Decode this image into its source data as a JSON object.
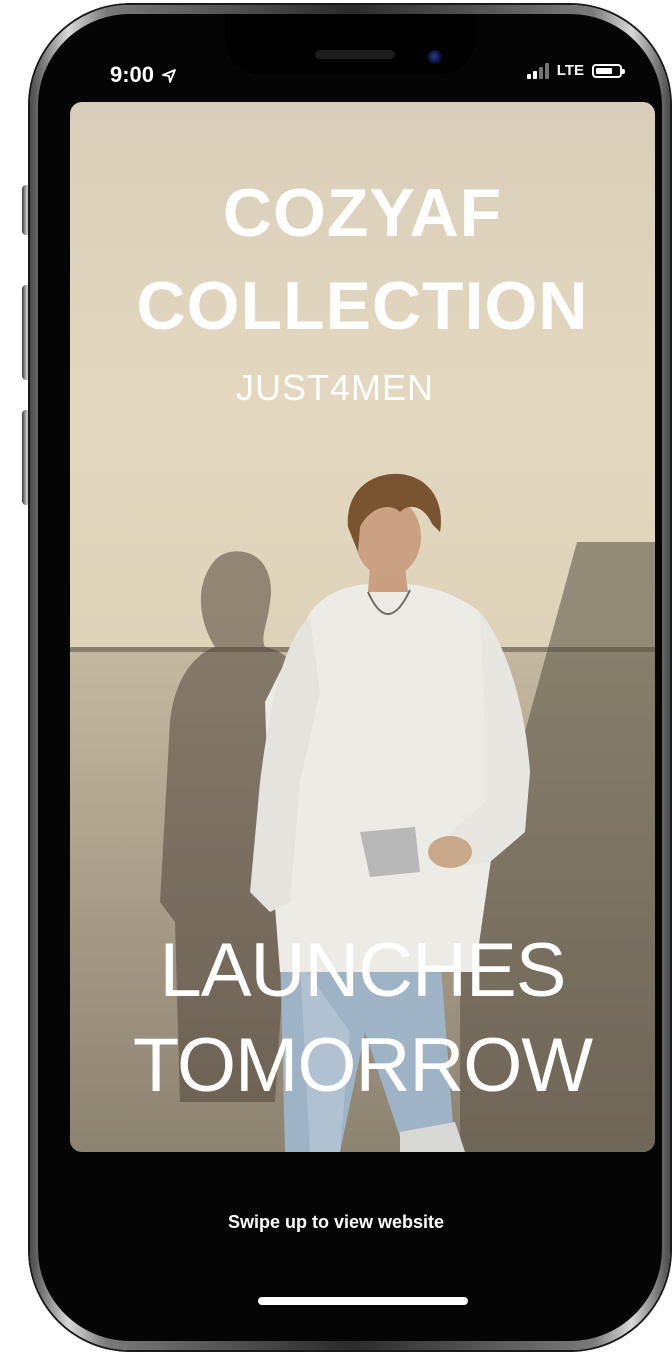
{
  "status_bar": {
    "time": "9:00",
    "carrier": "LTE"
  },
  "story": {
    "brand_title_line1": "COZYAF",
    "brand_title_line2": "COLLECTION",
    "subtitle": "JUST4MEN",
    "launch_line1": "LAUNCHES",
    "launch_line2": "TOMORROW"
  },
  "footer": {
    "swipe_label": "Swipe up to view website"
  },
  "icons": {
    "location": "location-arrow-icon",
    "signal": "cellular-signal-icon",
    "battery": "battery-icon"
  },
  "colors": {
    "background_beige": "#e4d8c0",
    "text": "#ffffff",
    "phone_screen": "#050505"
  }
}
